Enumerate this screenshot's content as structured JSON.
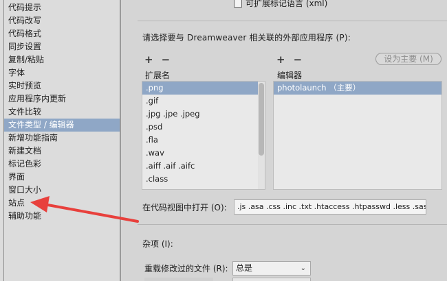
{
  "categories": [
    {
      "label": "代码提示"
    },
    {
      "label": "代码改写"
    },
    {
      "label": "代码格式"
    },
    {
      "label": "同步设置"
    },
    {
      "label": "复制/粘贴"
    },
    {
      "label": "字体"
    },
    {
      "label": "实时预览"
    },
    {
      "label": "应用程序内更新"
    },
    {
      "label": "文件比较"
    },
    {
      "label": "文件类型 / 编辑器",
      "selected": true
    },
    {
      "label": "新增功能指南"
    },
    {
      "label": "新建文档"
    },
    {
      "label": "标记色彩"
    },
    {
      "label": "界面"
    },
    {
      "label": "窗口大小"
    },
    {
      "label": "站点"
    },
    {
      "label": "辅助功能"
    }
  ],
  "top_checkbox_label": "可扩展标记语言 (xml)",
  "prompt": "请选择要与 Dreamweaver 相关联的外部应用程序 (P):",
  "extensions": {
    "plus": "+",
    "minus": "−",
    "header": "扩展名",
    "items": [
      {
        "label": ".png",
        "selected": true
      },
      {
        "label": ".gif"
      },
      {
        "label": ".jpg .jpe .jpeg"
      },
      {
        "label": ".psd"
      },
      {
        "label": ".fla"
      },
      {
        "label": ".wav"
      },
      {
        "label": ".aiff .aif .aifc"
      },
      {
        "label": ".class"
      }
    ]
  },
  "editors": {
    "plus": "+",
    "minus": "−",
    "header": "编辑器",
    "set_primary_label": "设为主要 (M)",
    "items": [
      {
        "label": "photolaunch （主要）",
        "selected": true
      }
    ]
  },
  "open_in_code_view": {
    "label": "在代码视图中打开 (O):",
    "value": ".js .asa .css .inc .txt .htaccess .htpasswd .less .sass .scss"
  },
  "misc_label": "杂项 (I):",
  "reload": {
    "label": "重载修改过的文件 (R):",
    "value": "总是"
  },
  "colors": {
    "selection": "#8fa7c6",
    "annotation_arrow": "#e8403c"
  }
}
